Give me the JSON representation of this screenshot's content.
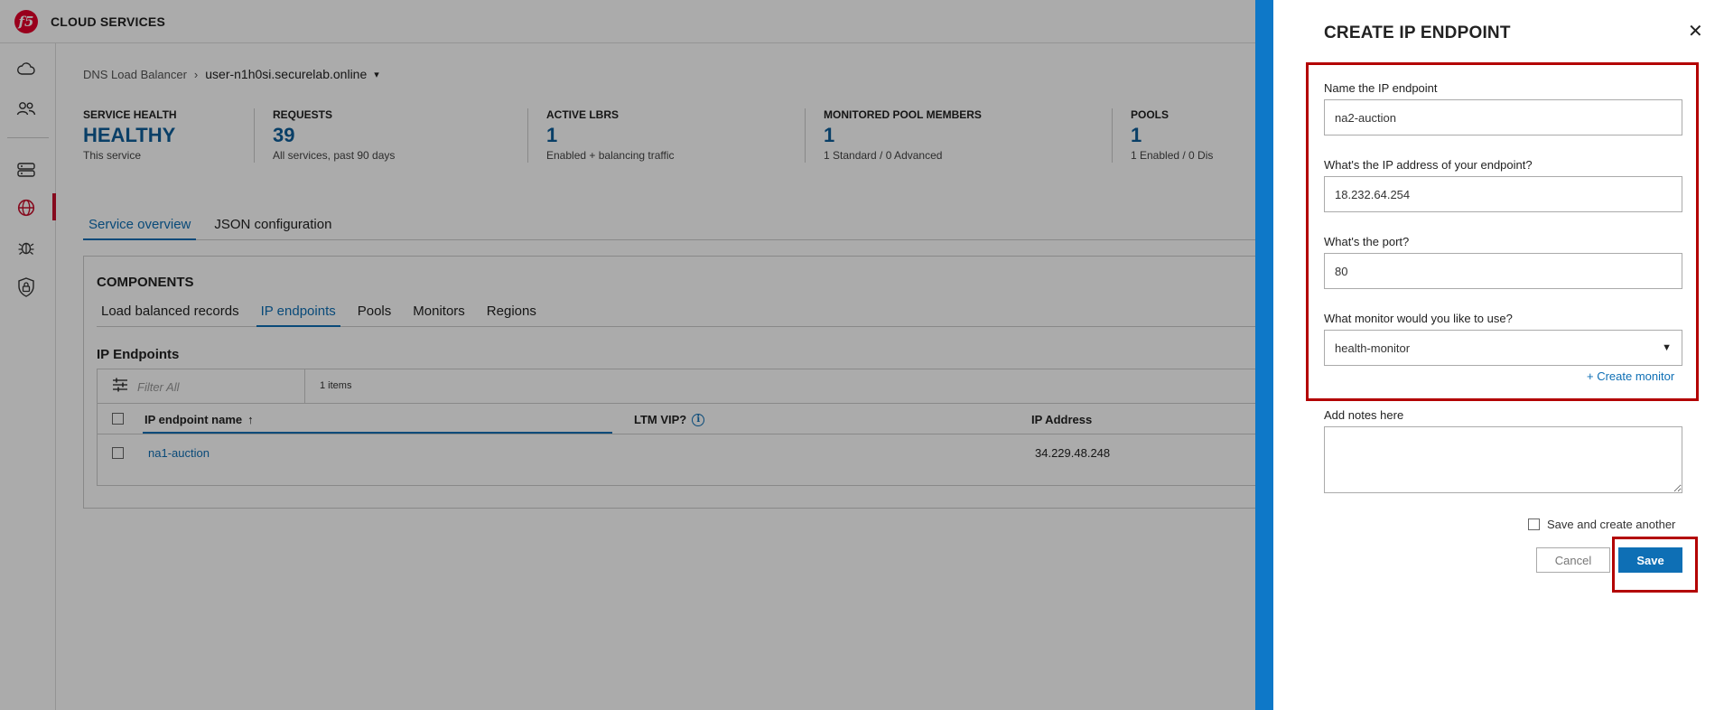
{
  "app": {
    "brand": "CLOUD SERVICES",
    "logo_glyph": "f5"
  },
  "colors": {
    "accent": "#0e6fb5",
    "stat_value": "#0e5e9a",
    "highlight": "#b30000",
    "drawer_stripe": "#0e78c8",
    "nav_active": "#c8102e"
  },
  "breadcrumb": {
    "root": "DNS Load Balancer",
    "separator": "›",
    "current": "user-n1h0si.securelab.online",
    "caret": "▾"
  },
  "stats": [
    {
      "label": "SERVICE HEALTH",
      "value": "HEALTHY",
      "sub": "This service"
    },
    {
      "label": "REQUESTS",
      "value": "39",
      "sub": "All services, past 90 days"
    },
    {
      "label": "ACTIVE LBRS",
      "value": "1",
      "sub": "Enabled + balancing traffic"
    },
    {
      "label": "MONITORED POOL MEMBERS",
      "value": "1",
      "sub": "1 Standard / 0 Advanced"
    },
    {
      "label": "POOLS",
      "value": "1",
      "sub": "1 Enabled / 0 Dis"
    }
  ],
  "main_tabs": [
    "Service overview",
    "JSON configuration"
  ],
  "components": {
    "title": "COMPONENTS",
    "tabs": [
      "Load balanced records",
      "IP endpoints",
      "Pools",
      "Monitors",
      "Regions"
    ]
  },
  "ip_endpoints": {
    "title": "IP Endpoints",
    "filter_placeholder": "Filter All",
    "count": "1 items",
    "columns": {
      "name": "IP endpoint name",
      "sort": "↑",
      "ltm": "LTM VIP?",
      "ip": "IP Address"
    },
    "rows": [
      {
        "name": "na1-auction",
        "ip": "34.229.48.248"
      }
    ]
  },
  "drawer": {
    "title": "CREATE IP ENDPOINT",
    "close": "✕",
    "name_label": "Name the IP endpoint",
    "name_value": "na2-auction",
    "ip_label": "What's the IP address of your endpoint?",
    "ip_value": "18.232.64.254",
    "port_label": "What's the port?",
    "port_value": "80",
    "monitor_label": "What monitor would you like to use?",
    "monitor_value": "health-monitor",
    "monitor_caret": "▼",
    "create_monitor": "+ Create monitor",
    "notes_label": "Add notes here",
    "save_another": "Save and create another",
    "cancel": "Cancel",
    "save": "Save"
  },
  "icons": [
    "cloud-icon",
    "users-icon",
    "server-icon",
    "globe-icon",
    "bug-icon",
    "shield-lock-icon",
    "filter-sliders-icon",
    "info-icon"
  ]
}
